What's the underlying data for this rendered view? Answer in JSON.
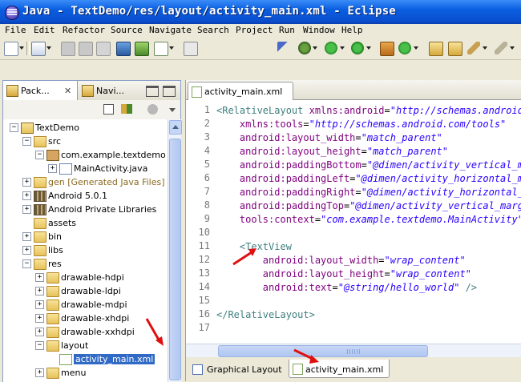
{
  "window": {
    "title": "Java - TextDemo/res/layout/activity_main.xml - Eclipse"
  },
  "menubar": {
    "items": [
      "File",
      "Edit",
      "Refactor",
      "Source",
      "Navigate",
      "Search",
      "Project",
      "Run",
      "Window",
      "Help"
    ]
  },
  "left_panel": {
    "tabs": [
      {
        "label": "Pack..."
      },
      {
        "label": "Navi..."
      }
    ],
    "tree": [
      {
        "label": "TextDemo",
        "toggle": "−",
        "icon": "project-icon"
      },
      {
        "label": "src",
        "toggle": "−",
        "icon": "source-folder-icon"
      },
      {
        "label": "com.example.textdemo",
        "toggle": "−",
        "icon": "package-icon"
      },
      {
        "label": "MainActivity.java",
        "toggle": "+",
        "icon": "java-file-icon"
      },
      {
        "label": "gen [Generated Java Files]",
        "toggle": "+",
        "icon": "source-folder-icon"
      },
      {
        "label": "Android 5.0.1",
        "toggle": "+",
        "icon": "library-icon"
      },
      {
        "label": "Android Private Libraries",
        "toggle": "+",
        "icon": "library-icon"
      },
      {
        "label": "assets",
        "toggle": "",
        "icon": "folder-icon"
      },
      {
        "label": "bin",
        "toggle": "+",
        "icon": "folder-icon"
      },
      {
        "label": "libs",
        "toggle": "+",
        "icon": "folder-icon"
      },
      {
        "label": "res",
        "toggle": "−",
        "icon": "folder-icon"
      },
      {
        "label": "drawable-hdpi",
        "toggle": "+",
        "icon": "folder-icon"
      },
      {
        "label": "drawable-ldpi",
        "toggle": "+",
        "icon": "folder-icon"
      },
      {
        "label": "drawable-mdpi",
        "toggle": "+",
        "icon": "folder-icon"
      },
      {
        "label": "drawable-xhdpi",
        "toggle": "+",
        "icon": "folder-icon"
      },
      {
        "label": "drawable-xxhdpi",
        "toggle": "+",
        "icon": "folder-icon"
      },
      {
        "label": "layout",
        "toggle": "−",
        "icon": "folder-icon"
      },
      {
        "label": "activity_main.xml",
        "toggle": "",
        "icon": "xml-file-icon",
        "selected": true
      },
      {
        "label": "menu",
        "toggle": "+",
        "icon": "folder-icon"
      }
    ]
  },
  "editor": {
    "tab": {
      "label": "activity_main.xml"
    },
    "line_numbers": [
      "1",
      "2",
      "3",
      "4",
      "5",
      "6",
      "7",
      "8",
      "9",
      "10",
      "11",
      "12",
      "13",
      "14",
      "15",
      "16",
      "17"
    ],
    "lines": [
      [
        [
          "tag",
          "<RelativeLayout "
        ],
        [
          "attr",
          "xmlns:android"
        ],
        [
          "eq",
          "="
        ],
        [
          "val",
          "\"http://schemas.android.com/apk/res/android\""
        ]
      ],
      [
        [
          "eq",
          "    "
        ],
        [
          "attr",
          "xmlns:tools"
        ],
        [
          "eq",
          "="
        ],
        [
          "val",
          "\"http://schemas.android.com/tools\""
        ]
      ],
      [
        [
          "eq",
          "    "
        ],
        [
          "attr",
          "android:layout_width"
        ],
        [
          "eq",
          "="
        ],
        [
          "val",
          "\"match_parent\""
        ]
      ],
      [
        [
          "eq",
          "    "
        ],
        [
          "attr",
          "android:layout_height"
        ],
        [
          "eq",
          "="
        ],
        [
          "val",
          "\"match_parent\""
        ]
      ],
      [
        [
          "eq",
          "    "
        ],
        [
          "attr",
          "android:paddingBottom"
        ],
        [
          "eq",
          "="
        ],
        [
          "val",
          "\"@dimen/activity_vertical_margin\""
        ]
      ],
      [
        [
          "eq",
          "    "
        ],
        [
          "attr",
          "android:paddingLeft"
        ],
        [
          "eq",
          "="
        ],
        [
          "val",
          "\"@dimen/activity_horizontal_margin\""
        ]
      ],
      [
        [
          "eq",
          "    "
        ],
        [
          "attr",
          "android:paddingRight"
        ],
        [
          "eq",
          "="
        ],
        [
          "val",
          "\"@dimen/activity_horizontal_margin\""
        ]
      ],
      [
        [
          "eq",
          "    "
        ],
        [
          "attr",
          "android:paddingTop"
        ],
        [
          "eq",
          "="
        ],
        [
          "val",
          "\"@dimen/activity_vertical_margin\""
        ]
      ],
      [
        [
          "eq",
          "    "
        ],
        [
          "attr",
          "tools:context"
        ],
        [
          "eq",
          "="
        ],
        [
          "val",
          "\"com.example.textdemo.MainActivity\""
        ],
        [
          "tag",
          " >"
        ]
      ],
      [],
      [
        [
          "eq",
          "    "
        ],
        [
          "tag",
          "<TextView"
        ]
      ],
      [
        [
          "eq",
          "        "
        ],
        [
          "attr",
          "android:layout_width"
        ],
        [
          "eq",
          "="
        ],
        [
          "val",
          "\"wrap_content\""
        ]
      ],
      [
        [
          "eq",
          "        "
        ],
        [
          "attr",
          "android:layout_height"
        ],
        [
          "eq",
          "="
        ],
        [
          "val",
          "\"wrap_content\""
        ]
      ],
      [
        [
          "eq",
          "        "
        ],
        [
          "attr",
          "android:text"
        ],
        [
          "eq",
          "="
        ],
        [
          "val",
          "\"@string/hello_world\""
        ],
        [
          "tag",
          " />"
        ]
      ],
      [],
      [
        [
          "tag",
          "</RelativeLayout>"
        ]
      ],
      []
    ]
  },
  "bottom_tabs": [
    {
      "label": "Graphical Layout"
    },
    {
      "label": "activity_main.xml"
    }
  ],
  "colors": {
    "title_bar": "#0a5ee0",
    "selection": "#316ac5",
    "tag": "#3f7f7f",
    "attr": "#7f007f",
    "value": "#2a00ff",
    "arrow": "#e01010"
  }
}
